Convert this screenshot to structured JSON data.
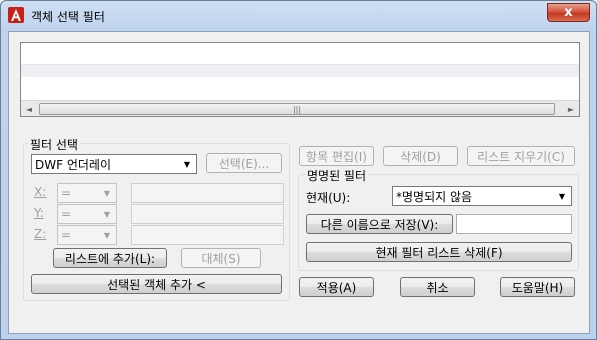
{
  "window": {
    "title": "객체 선택 필터",
    "close_label": "x"
  },
  "list": {
    "scroll_left": "◄",
    "scroll_right": "►",
    "scroll_grip": "|||"
  },
  "filter_select": {
    "group_label": "필터 선택",
    "type_value": "DWF 언더레이",
    "select_button": "선택(E)...",
    "x_label": "X:",
    "y_label": "Y:",
    "z_label": "Z:",
    "x_operator": "=",
    "y_operator": "=",
    "z_operator": "=",
    "add_to_list_button": "리스트에 추가(L):",
    "replace_button": "대체(S)",
    "add_selected_button": "선택된 객체 추가 <"
  },
  "list_actions": {
    "edit_item": "항목 편집(I)",
    "delete": "삭제(D)",
    "clear_list": "리스트 지우기(C)"
  },
  "named_filters": {
    "group_label": "명명된 필터",
    "current_label": "현재(U):",
    "current_value": "*명명되지 않음",
    "save_as_button": "다른 이름으로 저장(V):",
    "save_as_value": "",
    "delete_current_button": "현재 필터 리스트 삭제(F)"
  },
  "footer": {
    "apply": "적용(A)",
    "cancel": "취소",
    "help": "도움말(H)"
  },
  "colors": {
    "title_gradient_top": "#cfe0f3",
    "close_red": "#c13a22",
    "dialog_bg": "#f0f0f0"
  }
}
